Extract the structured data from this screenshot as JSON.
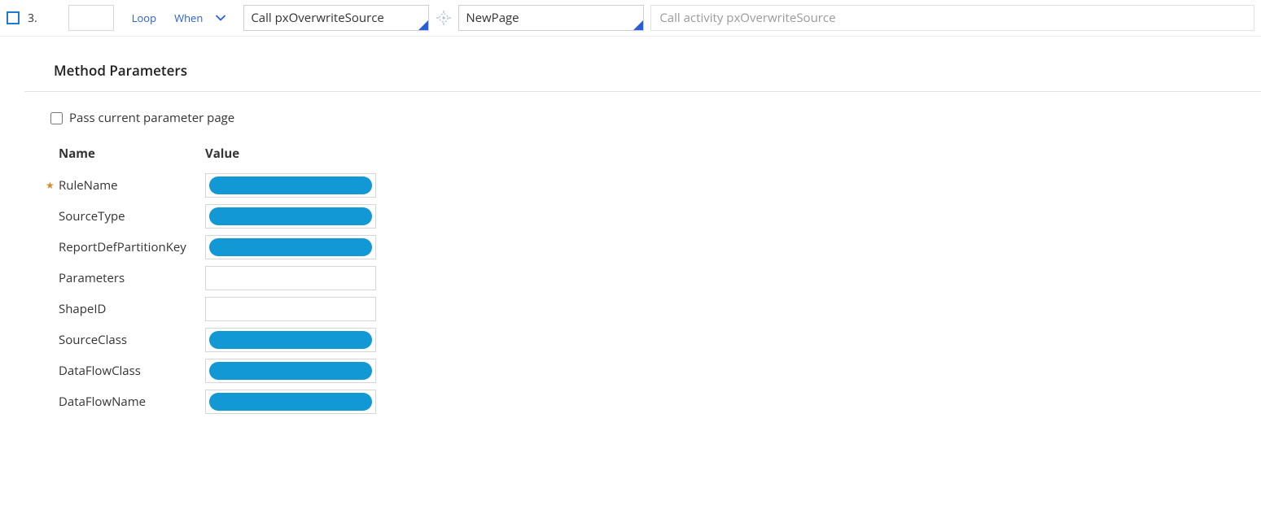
{
  "step": {
    "number": "3.",
    "loop_label": "Loop",
    "when_label": "When",
    "method_value": "Call pxOverwriteSource",
    "step_page_value": "NewPage",
    "description_placeholder": "Call activity pxOverwriteSource"
  },
  "section_title": "Method Parameters",
  "pass_param_label": "Pass current parameter page",
  "param_table": {
    "headers": {
      "name": "Name",
      "value": "Value"
    },
    "rows": [
      {
        "name": "RuleName",
        "required": true,
        "redacted": true
      },
      {
        "name": "SourceType",
        "required": false,
        "redacted": true
      },
      {
        "name": "ReportDefPartitionKey",
        "required": false,
        "redacted": true
      },
      {
        "name": "Parameters",
        "required": false,
        "redacted": false
      },
      {
        "name": "ShapeID",
        "required": false,
        "redacted": false
      },
      {
        "name": "SourceClass",
        "required": false,
        "redacted": true
      },
      {
        "name": "DataFlowClass",
        "required": false,
        "redacted": true
      },
      {
        "name": "DataFlowName",
        "required": false,
        "redacted": true
      }
    ]
  }
}
